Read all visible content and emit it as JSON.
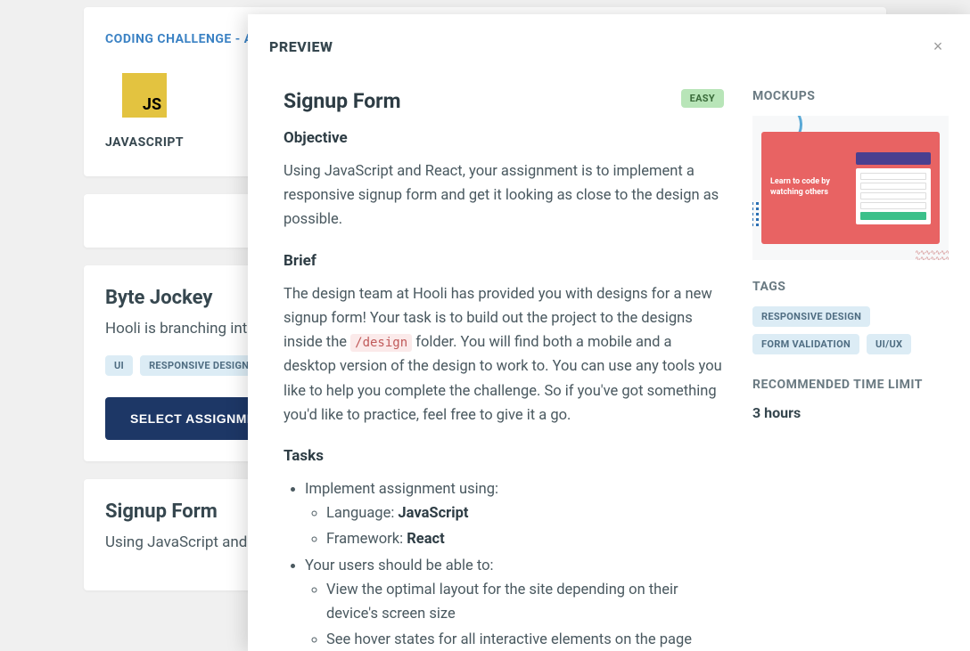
{
  "background": {
    "headerTitle": "CODING CHALLENGE - A",
    "language": {
      "iconText": "JS",
      "label": "JAVASCRIPT"
    },
    "card1": {
      "title": "Byte Jockey",
      "text": "Hooli is branching into",
      "tags": [
        "UI",
        "RESPONSIVE DESIGN"
      ],
      "button": "SELECT ASSIGNMEN"
    },
    "card2": {
      "title": "Signup Form",
      "text": "Using JavaScript and R"
    }
  },
  "modal": {
    "headerTitle": "PREVIEW",
    "assignmentTitle": "Signup Form",
    "difficulty": "EASY",
    "objective": {
      "heading": "Objective",
      "text": "Using JavaScript and React, your assignment is to implement a responsive signup form and get it looking as close to the design as possible."
    },
    "brief": {
      "heading": "Brief",
      "textBefore": "The design team at Hooli has provided you with designs for a new signup form! Your task is to build out the project to the designs inside the ",
      "code": "/design",
      "textAfter": " folder. You will find both a mobile and a desktop version of the design to work to. You can use any tools you like to help you complete the challenge. So if you've got something you'd like to practice, feel free to give it a go."
    },
    "tasks": {
      "heading": "Tasks",
      "item1": "Implement assignment using:",
      "item1a_label": "Language: ",
      "item1a_value": "JavaScript",
      "item1b_label": "Framework: ",
      "item1b_value": "React",
      "item2": "Your users should be able to:",
      "item2a": "View the optimal layout for the site depending on their device's screen size",
      "item2b": "See hover states for all interactive elements on the page"
    },
    "sidebar": {
      "mockupsHeading": "MOCKUPS",
      "mockupText": "Learn to code by watching others",
      "tagsHeading": "TAGS",
      "tags": [
        "RESPONSIVE DESIGN",
        "FORM VALIDATION",
        "UI/UX"
      ],
      "timeHeading": "RECOMMENDED TIME LIMIT",
      "timeValue": "3 hours"
    }
  }
}
